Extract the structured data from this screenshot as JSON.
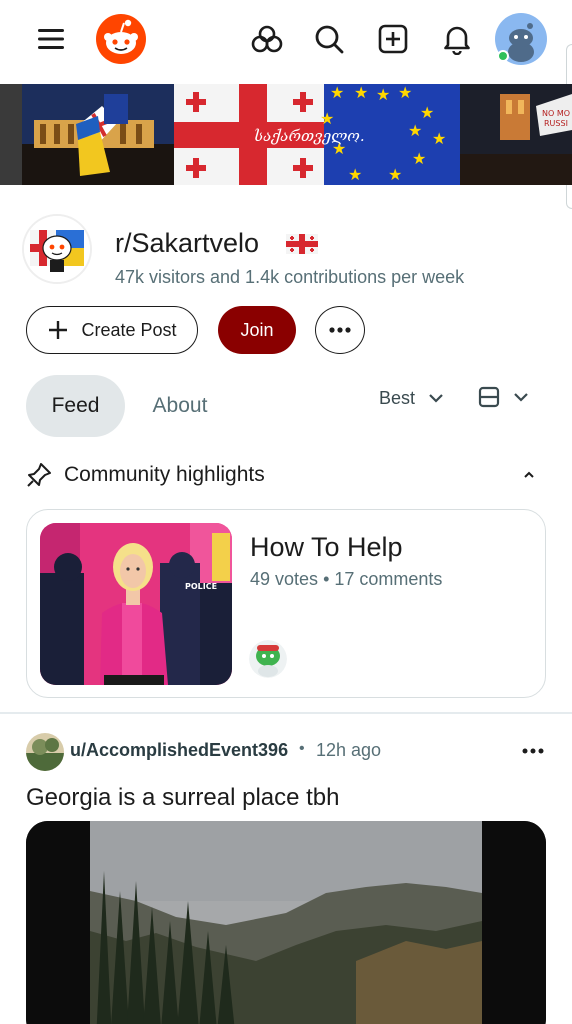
{
  "community": {
    "name": "r/Sakartvelo",
    "stats": "47k visitors and 1.4k contributions per week",
    "banner_text": "საქართველო."
  },
  "actions": {
    "create_post": "Create Post",
    "join": "Join"
  },
  "tabs": [
    {
      "label": "Feed",
      "selected": true
    },
    {
      "label": "About",
      "selected": false
    }
  ],
  "sort": {
    "label": "Best"
  },
  "highlights": {
    "title": "Community highlights",
    "card": {
      "title": "How To Help",
      "votes": "49 votes",
      "sep": "•",
      "comments": "17 comments",
      "image_text": "POLICE"
    }
  },
  "post": {
    "username": "u/AccomplishedEvent396",
    "sep": "•",
    "time": "12h ago",
    "title": "Georgia is a surreal place tbh"
  },
  "colors": {
    "brand": "#ff4500",
    "join": "#8a0000",
    "selected_tab": "#e2e7e9",
    "meta": "#576f76",
    "online": "#2ec05a"
  },
  "icons": [
    "menu-icon",
    "reddit-logo",
    "mod-icon",
    "search-icon",
    "plus-square-icon",
    "bell-icon",
    "user-avatar",
    "plus-icon",
    "ellipsis-icon",
    "chevron-down-icon",
    "card-view-icon",
    "pin-icon",
    "chevron-up-icon"
  ]
}
